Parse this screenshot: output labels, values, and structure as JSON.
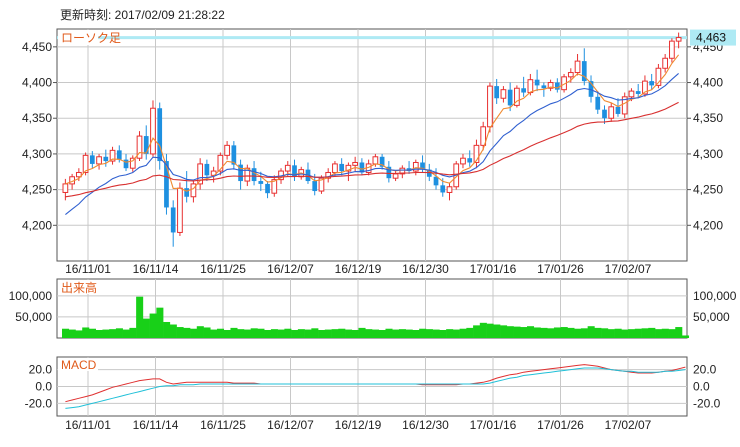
{
  "header": {
    "updated": "更新時刻: 2017/02/09 21:28:22"
  },
  "chart_data": [
    {
      "type": "candlestick",
      "title": "ローソク足",
      "x_tick_labels": [
        "16/11/01",
        "16/11/14",
        "16/11/25",
        "16/12/07",
        "16/12/19",
        "16/12/30",
        "17/01/16",
        "17/01/26",
        "17/02/07"
      ],
      "y_tick_labels": [
        "4,450",
        "4,400",
        "4,350",
        "4,300",
        "4,250",
        "4,200"
      ],
      "ylim": [
        4150,
        4475
      ],
      "last_value_label": "4,463",
      "last_value": 4463,
      "colors": {
        "up": "#e83030",
        "down": "#1e90e0",
        "ma_short": "#f08a30",
        "ma_mid": "#3060d0",
        "ma_long": "#d83030",
        "last_line": "#aeeaf4"
      },
      "candles": [
        [
          4246,
          4265,
          4235,
          4258
        ],
        [
          4258,
          4272,
          4250,
          4268
        ],
        [
          4268,
          4280,
          4262,
          4274
        ],
        [
          4274,
          4302,
          4270,
          4298
        ],
        [
          4298,
          4304,
          4280,
          4286
        ],
        [
          4286,
          4300,
          4278,
          4296
        ],
        [
          4296,
          4306,
          4282,
          4290
        ],
        [
          4290,
          4310,
          4285,
          4305
        ],
        [
          4305,
          4312,
          4288,
          4292
        ],
        [
          4292,
          4300,
          4276,
          4280
        ],
        [
          4280,
          4298,
          4275,
          4294
        ],
        [
          4294,
          4332,
          4290,
          4325
        ],
        [
          4325,
          4340,
          4292,
          4300
        ],
        [
          4300,
          4375,
          4296,
          4364
        ],
        [
          4364,
          4372,
          4278,
          4290
        ],
        [
          4290,
          4300,
          4215,
          4225
        ],
        [
          4225,
          4235,
          4170,
          4190
        ],
        [
          4190,
          4260,
          4185,
          4252
        ],
        [
          4252,
          4276,
          4232,
          4240
        ],
        [
          4240,
          4262,
          4232,
          4258
        ],
        [
          4258,
          4294,
          4250,
          4286
        ],
        [
          4286,
          4292,
          4262,
          4270
        ],
        [
          4270,
          4282,
          4260,
          4276
        ],
        [
          4276,
          4302,
          4270,
          4298
        ],
        [
          4298,
          4318,
          4292,
          4312
        ],
        [
          4312,
          4318,
          4278,
          4285
        ],
        [
          4285,
          4292,
          4250,
          4262
        ],
        [
          4262,
          4285,
          4255,
          4280
        ],
        [
          4280,
          4290,
          4256,
          4262
        ],
        [
          4262,
          4275,
          4248,
          4258
        ],
        [
          4258,
          4262,
          4238,
          4245
        ],
        [
          4245,
          4270,
          4240,
          4264
        ],
        [
          4264,
          4280,
          4258,
          4276
        ],
        [
          4276,
          4290,
          4268,
          4284
        ],
        [
          4284,
          4292,
          4262,
          4268
        ],
        [
          4268,
          4282,
          4264,
          4278
        ],
        [
          4278,
          4288,
          4258,
          4262
        ],
        [
          4262,
          4272,
          4242,
          4248
        ],
        [
          4248,
          4270,
          4244,
          4266
        ],
        [
          4266,
          4280,
          4260,
          4274
        ],
        [
          4274,
          4290,
          4268,
          4286
        ],
        [
          4286,
          4294,
          4270,
          4276
        ],
        [
          4276,
          4288,
          4262,
          4284
        ],
        [
          4284,
          4296,
          4276,
          4288
        ],
        [
          4288,
          4294,
          4270,
          4274
        ],
        [
          4274,
          4292,
          4270,
          4286
        ],
        [
          4286,
          4300,
          4282,
          4296
        ],
        [
          4296,
          4300,
          4278,
          4282
        ],
        [
          4282,
          4290,
          4260,
          4266
        ],
        [
          4266,
          4276,
          4262,
          4272
        ],
        [
          4272,
          4284,
          4266,
          4280
        ],
        [
          4280,
          4290,
          4272,
          4276
        ],
        [
          4276,
          4292,
          4270,
          4288
        ],
        [
          4288,
          4298,
          4274,
          4278
        ],
        [
          4278,
          4286,
          4262,
          4268
        ],
        [
          4268,
          4280,
          4250,
          4256
        ],
        [
          4256,
          4266,
          4240,
          4246
        ],
        [
          4246,
          4260,
          4235,
          4254
        ],
        [
          4254,
          4290,
          4250,
          4286
        ],
        [
          4286,
          4300,
          4280,
          4294
        ],
        [
          4294,
          4305,
          4282,
          4288
        ],
        [
          4288,
          4320,
          4280,
          4312
        ],
        [
          4312,
          4345,
          4305,
          4338
        ],
        [
          4338,
          4400,
          4330,
          4395
        ],
        [
          4395,
          4405,
          4370,
          4378
        ],
        [
          4378,
          4395,
          4372,
          4390
        ],
        [
          4390,
          4400,
          4360,
          4368
        ],
        [
          4368,
          4396,
          4365,
          4392
        ],
        [
          4392,
          4408,
          4380,
          4386
        ],
        [
          4386,
          4412,
          4382,
          4404
        ],
        [
          4404,
          4418,
          4388,
          4396
        ],
        [
          4396,
          4400,
          4380,
          4392
        ],
        [
          4392,
          4404,
          4388,
          4400
        ],
        [
          4400,
          4406,
          4386,
          4390
        ],
        [
          4390,
          4412,
          4386,
          4408
        ],
        [
          4408,
          4420,
          4400,
          4414
        ],
        [
          4414,
          4440,
          4410,
          4430
        ],
        [
          4430,
          4448,
          4396,
          4402
        ],
        [
          4402,
          4410,
          4372,
          4380
        ],
        [
          4380,
          4388,
          4356,
          4362
        ],
        [
          4362,
          4368,
          4342,
          4350
        ],
        [
          4350,
          4372,
          4345,
          4366
        ],
        [
          4366,
          4378,
          4352,
          4356
        ],
        [
          4356,
          4386,
          4350,
          4380
        ],
        [
          4380,
          4392,
          4374,
          4388
        ],
        [
          4388,
          4398,
          4378,
          4384
        ],
        [
          4384,
          4410,
          4380,
          4402
        ],
        [
          4402,
          4412,
          4390,
          4396
        ],
        [
          4396,
          4426,
          4392,
          4420
        ],
        [
          4420,
          4440,
          4414,
          4434
        ],
        [
          4434,
          4462,
          4428,
          4458
        ],
        [
          4458,
          4470,
          4448,
          4463
        ]
      ]
    },
    {
      "type": "bar",
      "title": "出来高",
      "y_tick_labels": [
        "100,000",
        "50,000"
      ],
      "ylim": [
        0,
        140000
      ],
      "color": "#18d018",
      "values": [
        22000,
        20000,
        18000,
        25000,
        22000,
        19000,
        20000,
        21000,
        23000,
        20000,
        24000,
        98000,
        46000,
        58000,
        72000,
        38000,
        32000,
        26000,
        24000,
        22000,
        28000,
        25000,
        20000,
        22000,
        19000,
        24000,
        21000,
        20000,
        23000,
        22000,
        19000,
        21000,
        20000,
        22000,
        19000,
        21000,
        20000,
        23000,
        19000,
        20000,
        21000,
        22000,
        20000,
        19000,
        24000,
        21000,
        20000,
        19000,
        22000,
        20000,
        21000,
        20000,
        19000,
        22000,
        21000,
        20000,
        19000,
        21000,
        20000,
        22000,
        24000,
        30000,
        36000,
        34000,
        32000,
        30000,
        28000,
        27000,
        26000,
        28000,
        25000,
        24000,
        23000,
        25000,
        26000,
        24000,
        22000,
        23000,
        28000,
        24000,
        23000,
        21000,
        22000,
        20000,
        21000,
        22000,
        23000,
        24000,
        21000,
        22000,
        21000,
        26000,
        6000
      ]
    },
    {
      "type": "line",
      "title": "MACD",
      "y_tick_labels": [
        "20.0",
        "0.0",
        "-20.0"
      ],
      "ylim": [
        -35,
        35
      ],
      "series": [
        {
          "color": "#e03030",
          "values": [
            -18,
            -16,
            -14,
            -12,
            -10,
            -7,
            -4,
            -1,
            1,
            3,
            5,
            7,
            8,
            9,
            9,
            5,
            3,
            4,
            5,
            5,
            5,
            5,
            5,
            5,
            5,
            4,
            4,
            4,
            4,
            3,
            3,
            3,
            3,
            3,
            3,
            3,
            3,
            3,
            3,
            3,
            3,
            3,
            3,
            3,
            3,
            3,
            3,
            3,
            3,
            3,
            3,
            3,
            3,
            2,
            2,
            2,
            2,
            2,
            2,
            3,
            3,
            4,
            5,
            7,
            10,
            12,
            14,
            15,
            17,
            18,
            19,
            20,
            21,
            22,
            23,
            24,
            25,
            26,
            25,
            24,
            22,
            20,
            19,
            18,
            17,
            16,
            16,
            16,
            17,
            18,
            19,
            21,
            23
          ]
        },
        {
          "color": "#20c0d8",
          "values": [
            -26,
            -25,
            -24,
            -22,
            -20,
            -18,
            -16,
            -14,
            -12,
            -10,
            -8,
            -6,
            -4,
            -2,
            0,
            1,
            1,
            2,
            2,
            2,
            3,
            3,
            3,
            3,
            3,
            3,
            3,
            3,
            3,
            3,
            3,
            3,
            3,
            3,
            3,
            3,
            3,
            3,
            3,
            3,
            3,
            3,
            3,
            3,
            3,
            3,
            3,
            3,
            3,
            3,
            3,
            3,
            3,
            3,
            3,
            3,
            3,
            3,
            3,
            3,
            3,
            3,
            3,
            4,
            6,
            8,
            10,
            11,
            13,
            14,
            15,
            16,
            17,
            18,
            19,
            20,
            21,
            22,
            22,
            22,
            21,
            20,
            19,
            18,
            18,
            17,
            17,
            17,
            17,
            18,
            18,
            19,
            20
          ]
        }
      ]
    }
  ]
}
